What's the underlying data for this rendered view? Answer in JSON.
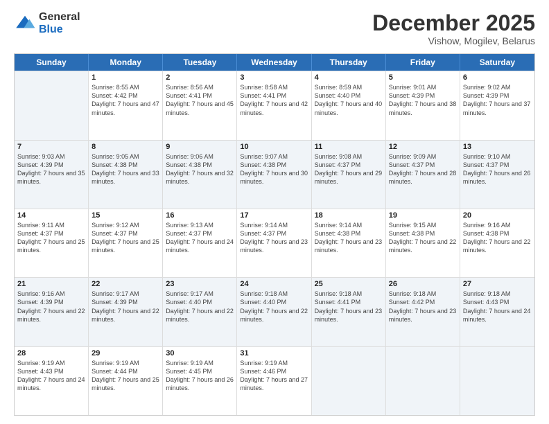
{
  "logo": {
    "general": "General",
    "blue": "Blue"
  },
  "header": {
    "title": "December 2025",
    "subtitle": "Vishow, Mogilev, Belarus"
  },
  "days_of_week": [
    "Sunday",
    "Monday",
    "Tuesday",
    "Wednesday",
    "Thursday",
    "Friday",
    "Saturday"
  ],
  "weeks": [
    [
      {
        "day": "",
        "empty": true
      },
      {
        "day": "1",
        "sunrise": "8:55 AM",
        "sunset": "4:42 PM",
        "daylight": "7 hours and 47 minutes."
      },
      {
        "day": "2",
        "sunrise": "8:56 AM",
        "sunset": "4:41 PM",
        "daylight": "7 hours and 45 minutes."
      },
      {
        "day": "3",
        "sunrise": "8:58 AM",
        "sunset": "4:41 PM",
        "daylight": "7 hours and 42 minutes."
      },
      {
        "day": "4",
        "sunrise": "8:59 AM",
        "sunset": "4:40 PM",
        "daylight": "7 hours and 40 minutes."
      },
      {
        "day": "5",
        "sunrise": "9:01 AM",
        "sunset": "4:39 PM",
        "daylight": "7 hours and 38 minutes."
      },
      {
        "day": "6",
        "sunrise": "9:02 AM",
        "sunset": "4:39 PM",
        "daylight": "7 hours and 37 minutes."
      }
    ],
    [
      {
        "day": "7",
        "sunrise": "9:03 AM",
        "sunset": "4:39 PM",
        "daylight": "7 hours and 35 minutes."
      },
      {
        "day": "8",
        "sunrise": "9:05 AM",
        "sunset": "4:38 PM",
        "daylight": "7 hours and 33 minutes."
      },
      {
        "day": "9",
        "sunrise": "9:06 AM",
        "sunset": "4:38 PM",
        "daylight": "7 hours and 32 minutes."
      },
      {
        "day": "10",
        "sunrise": "9:07 AM",
        "sunset": "4:38 PM",
        "daylight": "7 hours and 30 minutes."
      },
      {
        "day": "11",
        "sunrise": "9:08 AM",
        "sunset": "4:37 PM",
        "daylight": "7 hours and 29 minutes."
      },
      {
        "day": "12",
        "sunrise": "9:09 AM",
        "sunset": "4:37 PM",
        "daylight": "7 hours and 28 minutes."
      },
      {
        "day": "13",
        "sunrise": "9:10 AM",
        "sunset": "4:37 PM",
        "daylight": "7 hours and 26 minutes."
      }
    ],
    [
      {
        "day": "14",
        "sunrise": "9:11 AM",
        "sunset": "4:37 PM",
        "daylight": "7 hours and 25 minutes."
      },
      {
        "day": "15",
        "sunrise": "9:12 AM",
        "sunset": "4:37 PM",
        "daylight": "7 hours and 25 minutes."
      },
      {
        "day": "16",
        "sunrise": "9:13 AM",
        "sunset": "4:37 PM",
        "daylight": "7 hours and 24 minutes."
      },
      {
        "day": "17",
        "sunrise": "9:14 AM",
        "sunset": "4:37 PM",
        "daylight": "7 hours and 23 minutes."
      },
      {
        "day": "18",
        "sunrise": "9:14 AM",
        "sunset": "4:38 PM",
        "daylight": "7 hours and 23 minutes."
      },
      {
        "day": "19",
        "sunrise": "9:15 AM",
        "sunset": "4:38 PM",
        "daylight": "7 hours and 22 minutes."
      },
      {
        "day": "20",
        "sunrise": "9:16 AM",
        "sunset": "4:38 PM",
        "daylight": "7 hours and 22 minutes."
      }
    ],
    [
      {
        "day": "21",
        "sunrise": "9:16 AM",
        "sunset": "4:39 PM",
        "daylight": "7 hours and 22 minutes."
      },
      {
        "day": "22",
        "sunrise": "9:17 AM",
        "sunset": "4:39 PM",
        "daylight": "7 hours and 22 minutes."
      },
      {
        "day": "23",
        "sunrise": "9:17 AM",
        "sunset": "4:40 PM",
        "daylight": "7 hours and 22 minutes."
      },
      {
        "day": "24",
        "sunrise": "9:18 AM",
        "sunset": "4:40 PM",
        "daylight": "7 hours and 22 minutes."
      },
      {
        "day": "25",
        "sunrise": "9:18 AM",
        "sunset": "4:41 PM",
        "daylight": "7 hours and 23 minutes."
      },
      {
        "day": "26",
        "sunrise": "9:18 AM",
        "sunset": "4:42 PM",
        "daylight": "7 hours and 23 minutes."
      },
      {
        "day": "27",
        "sunrise": "9:18 AM",
        "sunset": "4:43 PM",
        "daylight": "7 hours and 24 minutes."
      }
    ],
    [
      {
        "day": "28",
        "sunrise": "9:19 AM",
        "sunset": "4:43 PM",
        "daylight": "7 hours and 24 minutes."
      },
      {
        "day": "29",
        "sunrise": "9:19 AM",
        "sunset": "4:44 PM",
        "daylight": "7 hours and 25 minutes."
      },
      {
        "day": "30",
        "sunrise": "9:19 AM",
        "sunset": "4:45 PM",
        "daylight": "7 hours and 26 minutes."
      },
      {
        "day": "31",
        "sunrise": "9:19 AM",
        "sunset": "4:46 PM",
        "daylight": "7 hours and 27 minutes."
      },
      {
        "day": "",
        "empty": true
      },
      {
        "day": "",
        "empty": true
      },
      {
        "day": "",
        "empty": true
      }
    ]
  ]
}
